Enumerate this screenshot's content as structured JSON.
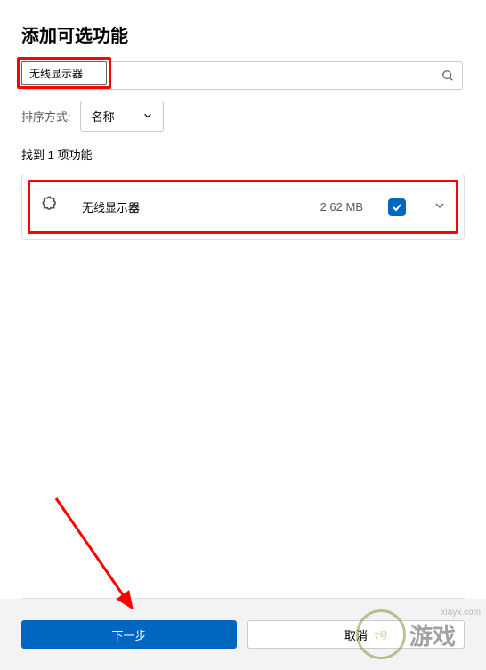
{
  "header": {
    "title": "添加可选功能"
  },
  "search": {
    "value": "无线显示器"
  },
  "sort": {
    "label": "排序方式:",
    "selected": "名称"
  },
  "results": {
    "count_text": "找到 1 项功能",
    "items": [
      {
        "name": "无线显示器",
        "size": "2.62 MB",
        "checked": true
      }
    ]
  },
  "footer": {
    "next": "下一步",
    "cancel": "取消"
  },
  "watermark": {
    "url": "xiayx.com",
    "brand": "游戏"
  }
}
